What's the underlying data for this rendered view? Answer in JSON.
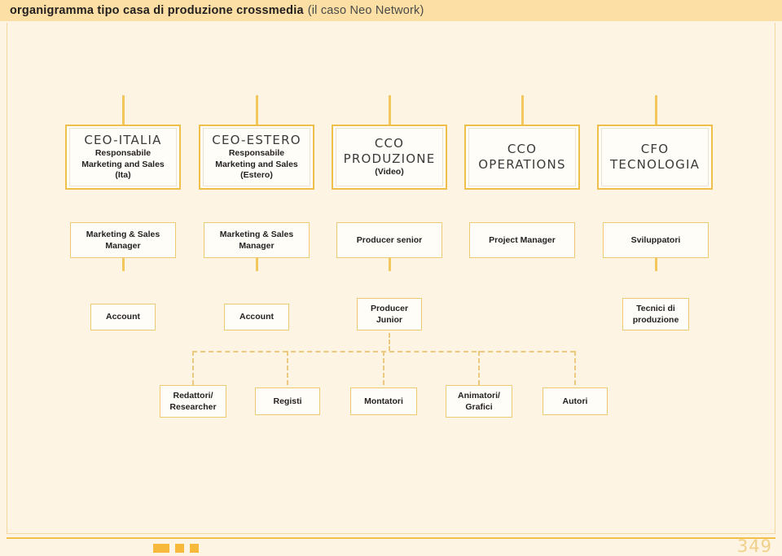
{
  "header": {
    "title_bold": "organigramma tipo casa di produzione crossmedia",
    "title_light": "(il caso Neo Network)"
  },
  "footer": {
    "page_number": "349"
  },
  "colors": {
    "page_background": "#fdf4e3",
    "header_background": "#fbdfa4",
    "accent_line": "#f2c75c",
    "dashed_line": "#ecc97f",
    "box_border": "#edc96f",
    "exec_border": "#f0bf49",
    "box_fill": "#fffdf8",
    "text_dark": "#231f20",
    "page_number_color": "#f0d08a",
    "footer_mark": "#f6b93b"
  },
  "chart_data": {
    "type": "diagram",
    "title": "organigramma tipo casa di produzione crossmedia (il caso Neo Network)",
    "columns": [
      {
        "id": "col-ceo-italia",
        "level1": {
          "title": "CEO-ITALIA",
          "subtitle": "Responsabile\nMarketing and Sales\n(Ita)"
        },
        "level2": "Marketing & Sales\nManager",
        "level3": "Account",
        "level4": null
      },
      {
        "id": "col-ceo-estero",
        "level1": {
          "title": "CEO-ESTERO",
          "subtitle": "Responsabile\nMarketing and Sales\n(Estero)"
        },
        "level2": "Marketing & Sales\nManager",
        "level3": "Account",
        "level4": null
      },
      {
        "id": "col-cco-produzione",
        "level1": {
          "title": "CCO\nPRODUZIONE",
          "subtitle": "(Video)"
        },
        "level2": "Producer senior",
        "level3": "Producer\nJunior",
        "level4": null
      },
      {
        "id": "col-cco-operations",
        "level1": {
          "title": "CCO\nOPERATIONS",
          "subtitle": ""
        },
        "level2": "Project Manager",
        "level3": null,
        "level4": null
      },
      {
        "id": "col-cfo-tecnologia",
        "level1": {
          "title": "CFO\nTECNOLOGIA",
          "subtitle": ""
        },
        "level2": "Sviluppatori",
        "level3": "Tecnici di\nproduzione",
        "level4": null
      }
    ],
    "bottom_row": [
      "Redattori/\nResearcher",
      "Registi",
      "Montatori",
      "Animatori/\nGrafici",
      "Autori"
    ],
    "bottom_row_connector": "dashed",
    "notes": "Bottom row boxes hang from a single dashed bus that descends from the Producer Junior node."
  }
}
